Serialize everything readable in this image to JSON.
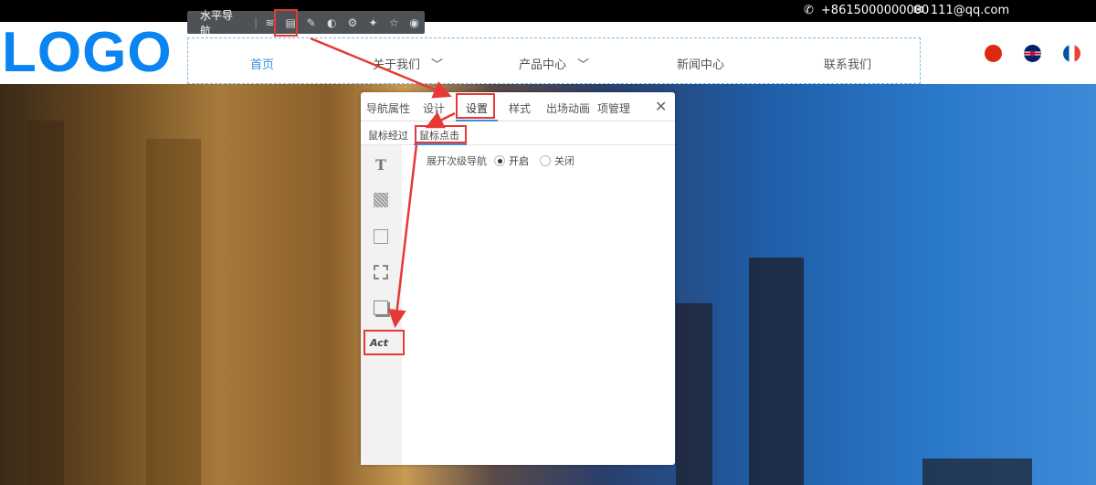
{
  "topbar": {
    "phone": "+8615000000000",
    "email": "111@qq.com"
  },
  "logo": "LOGO",
  "nav": [
    {
      "label": "首页",
      "active": true
    },
    {
      "label": "关于我们",
      "dropdown": true
    },
    {
      "label": "产品中心",
      "dropdown": true
    },
    {
      "label": "新闻中心"
    },
    {
      "label": "联系我们"
    }
  ],
  "languages": [
    "chinese",
    "english",
    "french"
  ],
  "toolbar": {
    "title": "水平导航",
    "icons": [
      "layers-icon",
      "settings-form-icon",
      "wrench-icon",
      "palette-icon",
      "gear-icon",
      "magic-icon",
      "star-icon",
      "eye-icon"
    ]
  },
  "panel": {
    "tabs": [
      "导航属性",
      "设计",
      "设置",
      "样式",
      "出场动画",
      "项管理"
    ],
    "active_tab": "设置",
    "subtabs": [
      "鼠标经过",
      "鼠标点击"
    ],
    "active_subtab": "鼠标点击",
    "setting_label": "展开次级导航",
    "options": [
      {
        "label": "开启",
        "checked": true
      },
      {
        "label": "关闭",
        "checked": false
      }
    ],
    "side_icons": [
      "text-icon",
      "background-icon",
      "layout-icon",
      "border-icon",
      "shadow-icon"
    ],
    "act_label": "Act"
  },
  "colors": {
    "accent": "#0a84f0",
    "highlight": "#e53935"
  }
}
